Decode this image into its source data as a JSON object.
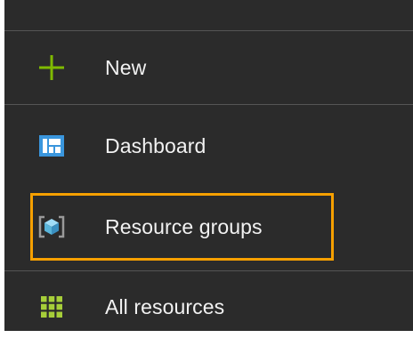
{
  "sidebar": {
    "items": [
      {
        "label": "New",
        "icon": "plus-icon"
      },
      {
        "label": "Dashboard",
        "icon": "dashboard-icon"
      },
      {
        "label": "Resource groups",
        "icon": "resource-group-icon",
        "highlighted": true
      },
      {
        "label": "All resources",
        "icon": "grid-icon"
      }
    ]
  },
  "colors": {
    "background": "#2b2b2b",
    "text": "#f2f2f2",
    "highlight": "#f6a000",
    "plus": "#7fba00",
    "dashboard": "#3a96dd",
    "resource_group": "#59b4d9",
    "all_resources": "#a6ce39"
  }
}
